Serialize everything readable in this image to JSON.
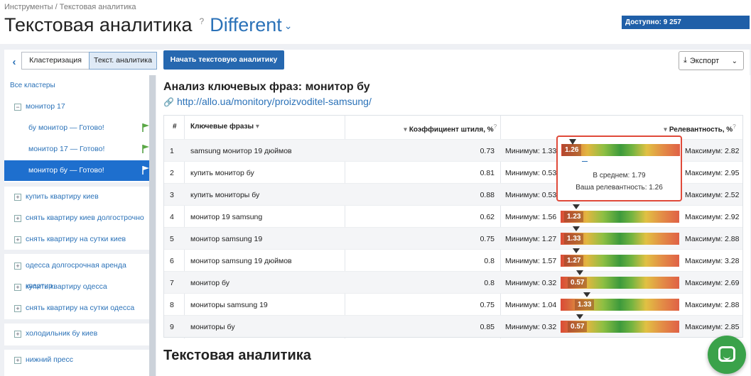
{
  "breadcrumb": "Инструменты / Текстовая аналитика",
  "header": {
    "title": "Текстовая аналитика",
    "help": "?",
    "project": "Different",
    "available": "Доступно: 9 257"
  },
  "toolbar": {
    "tab_cluster": "Кластеризация",
    "tab_text": "Текст. аналитика",
    "start_button": "Начать текстовую аналитику",
    "export_button": "Экспорт"
  },
  "sidebar": {
    "all_clusters": "Все кластеры",
    "cluster_root": "монитор 17",
    "children": [
      {
        "label": "бу монитор — Готово!",
        "active": false
      },
      {
        "label": "монитор 17 — Готово!",
        "active": false
      },
      {
        "label": "монитор бу — Готово!",
        "active": true
      }
    ],
    "groups": [
      "купить квартиру киев",
      "снять квартиру киев долгострочно",
      "снять квартиру на сутки киев",
      "одесса долгосрочная аренда квартир",
      "купить квартиру одесса",
      "снять квартиру на сутки одесса",
      "холодильник бу киев",
      "нижний пресс"
    ]
  },
  "main": {
    "section_title": "Анализ ключевых фраз: монитор бу",
    "url": "http://allo.ua/monitory/proizvoditel-samsung/",
    "columns": {
      "num": "#",
      "keywords": "Ключевые фразы",
      "coef": "Коэффициент штиля, %",
      "relevance": "Релевантность, %"
    },
    "rows": [
      {
        "num": "1",
        "kw": "samsung монитор 19 дюймов",
        "coef": "0.73",
        "min": "Минимум: 1.33",
        "max": "Максимум: 2.82",
        "value": "1.26",
        "pos": 0.03
      },
      {
        "num": "2",
        "kw": "купить монитор бу",
        "coef": "0.81",
        "min": "Минимум: 0.53",
        "max": "Максимум: 2.95",
        "value": "",
        "pos": 0.0
      },
      {
        "num": "3",
        "kw": "купить мониторы бу",
        "coef": "0.88",
        "min": "Минимум: 0.53",
        "max": "Максимум: 2.52",
        "value": "",
        "pos": 0.0
      },
      {
        "num": "4",
        "kw": "монитор 19 samsung",
        "coef": "0.62",
        "min": "Минимум: 1.56",
        "max": "Максимум: 2.92",
        "value": "1.23",
        "pos": 0.03
      },
      {
        "num": "5",
        "kw": "монитор samsung 19",
        "coef": "0.75",
        "min": "Минимум: 1.27",
        "max": "Максимум: 2.88",
        "value": "1.33",
        "pos": 0.03
      },
      {
        "num": "6",
        "kw": "монитор samsung 19 дюймов",
        "coef": "0.8",
        "min": "Минимум: 1.57",
        "max": "Максимум: 3.28",
        "value": "1.27",
        "pos": 0.03
      },
      {
        "num": "7",
        "kw": "монитор бу",
        "coef": "0.8",
        "min": "Минимум: 0.32",
        "max": "Максимум: 2.69",
        "value": "0.57",
        "pos": 0.06
      },
      {
        "num": "8",
        "kw": "мониторы samsung 19",
        "coef": "0.75",
        "min": "Минимум: 1.04",
        "max": "Максимум: 2.88",
        "value": "1.33",
        "pos": 0.12
      },
      {
        "num": "9",
        "kw": "мониторы бу",
        "coef": "0.85",
        "min": "Минимум: 0.32",
        "max": "Максимум: 2.85",
        "value": "0.57",
        "pos": 0.06
      }
    ],
    "tooltip": {
      "value": "1.26",
      "average": "В среднем: 1.79",
      "yours": "Ваша релевантность: 1.26"
    },
    "bottom_title": "Текстовая аналитика"
  },
  "colors": {
    "accent": "#2668b0",
    "active_item": "#1e6fce",
    "tooltip_border": "#e04a3a",
    "chat": "#3aa24a"
  }
}
